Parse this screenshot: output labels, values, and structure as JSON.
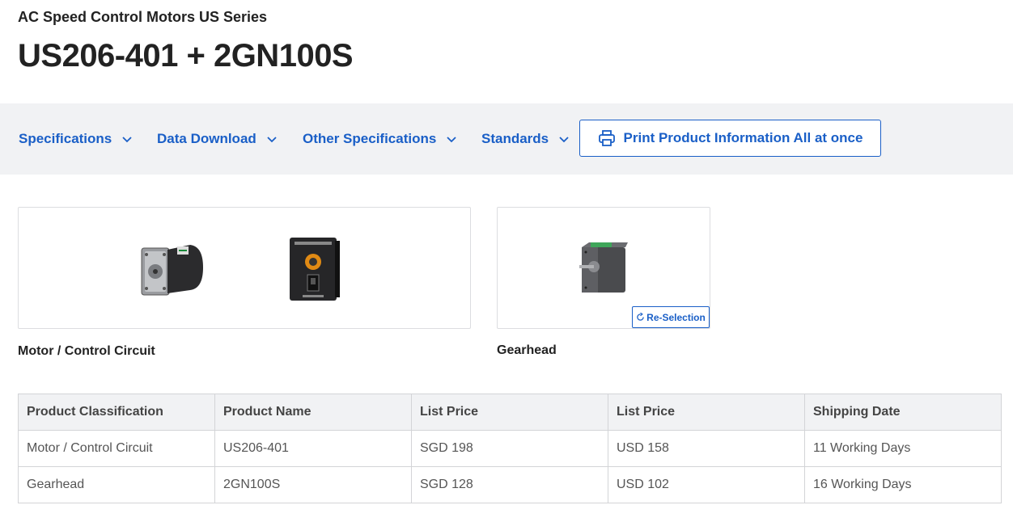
{
  "header": {
    "series": "AC Speed Control Motors US Series",
    "title": "US206-401 + 2GN100S"
  },
  "nav": {
    "items": [
      {
        "label": "Specifications"
      },
      {
        "label": "Data Download"
      },
      {
        "label": "Other Specifications"
      },
      {
        "label": "Standards"
      }
    ],
    "print_label": "Print Product Information All at once",
    "print_icon": "printer-icon",
    "chevron_icon": "chevron-down-icon"
  },
  "products": {
    "motor_label": "Motor / Control Circuit",
    "gear_label": "Gearhead",
    "reselect_label": "Re-Selection",
    "reselect_icon": "refresh-icon"
  },
  "table": {
    "headers": [
      "Product Classification",
      "Product Name",
      "List Price",
      "List Price",
      "Shipping Date"
    ],
    "rows": [
      [
        "Motor / Control Circuit",
        "US206-401",
        "SGD 198",
        "USD 158",
        "11 Working Days"
      ],
      [
        "Gearhead",
        "2GN100S",
        "SGD 128",
        "USD 102",
        "16 Working Days"
      ]
    ]
  },
  "colors": {
    "accent": "#1a5fc7",
    "nav_bg": "#f1f2f4"
  }
}
